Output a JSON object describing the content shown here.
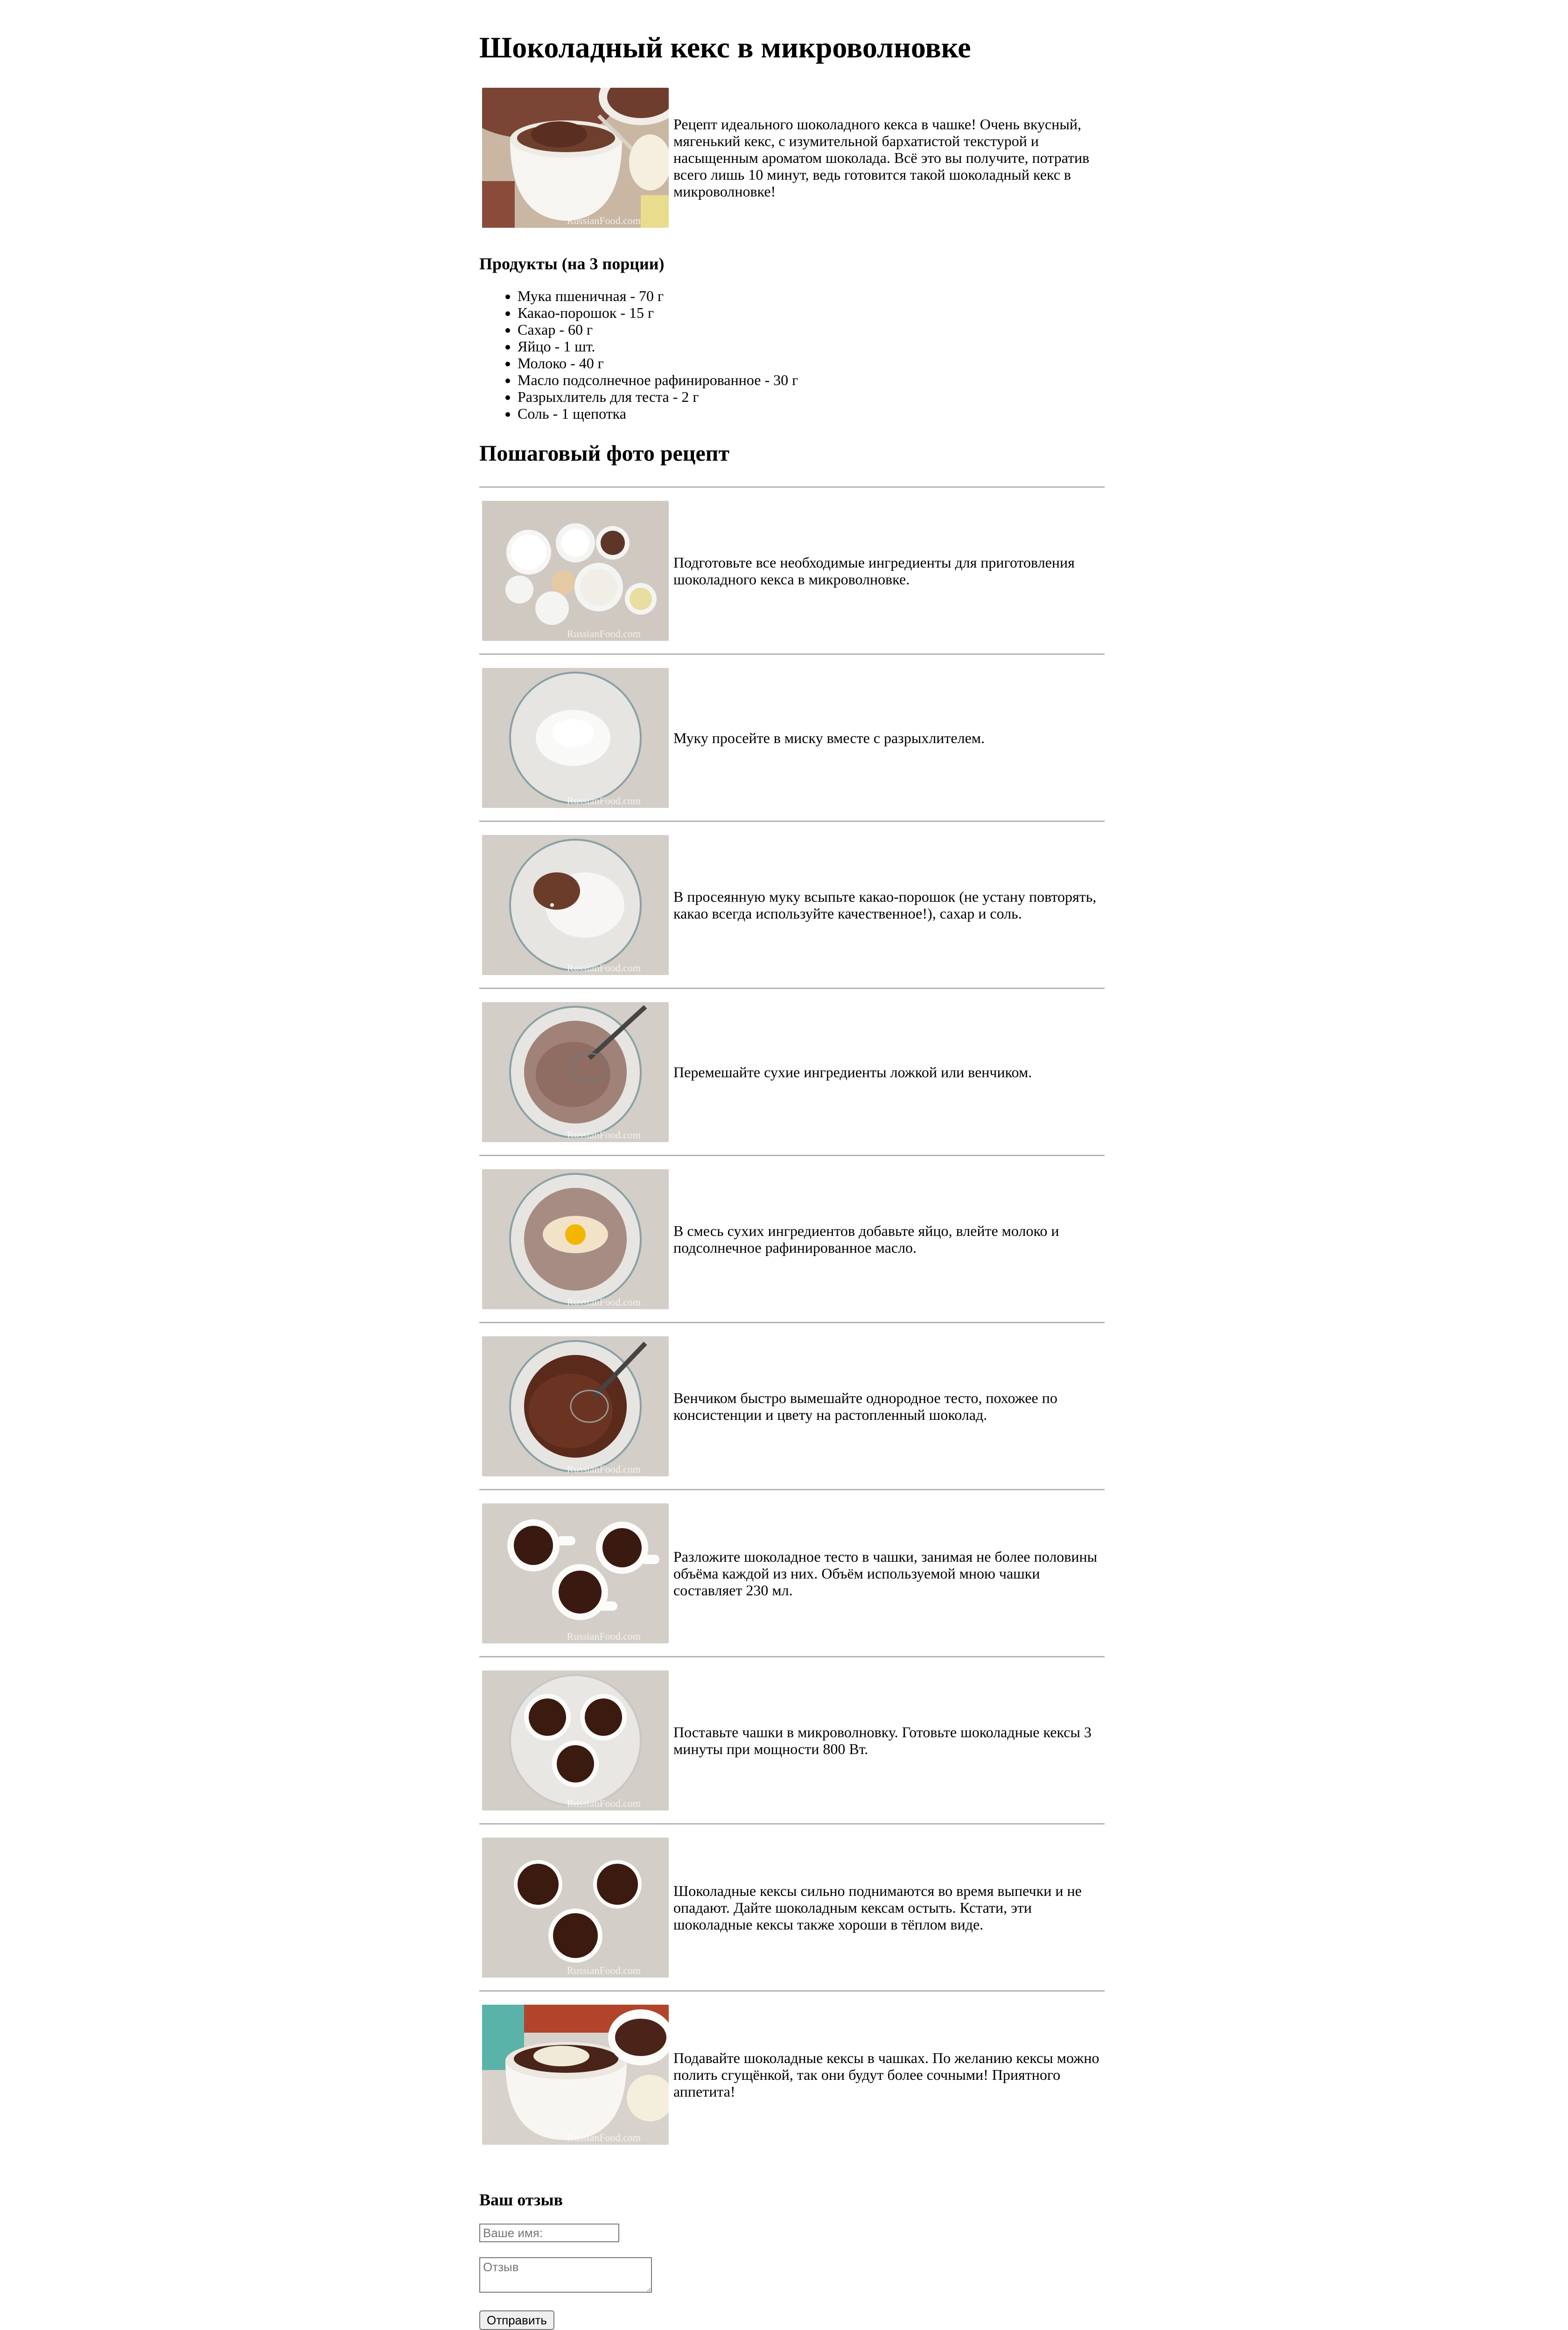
{
  "title": "Шоколадный кекс в микроволновке",
  "intro_text": "Рецепт идеального шоколадного кекса в чашке! Очень вкусный, мягенький кекс, с изумительной бархатистой текстурой и насыщенным ароматом шоколада. Всё это вы получите, потратив всего лишь 10 минут, ведь готовится такой шоколадный кекс в микроволновке!",
  "watermark": "RussianFood.com",
  "ingredients_heading": "Продукты (на 3 порции)",
  "ingredients": [
    "Мука пшеничная - 70 г",
    "Какао-порошок - 15 г",
    "Сахар - 60 г",
    "Яйцо - 1 шт.",
    "Молоко - 40 г",
    "Масло подсолнечное рафинированное - 30 г",
    "Разрыхлитель для теста - 2 г",
    "Соль - 1 щепотка"
  ],
  "steps_heading": "Пошаговый фото рецепт",
  "steps": [
    {
      "text": "Подготовьте все необходимые ингредиенты для приготовления шоколадного кекса в микроволновке."
    },
    {
      "text": "Муку просейте в миску вместе с разрыхлителем."
    },
    {
      "text": "В просеянную муку всыпьте какао-порошок (не устану повторять, какао всегда используйте качественное!), сахар и соль."
    },
    {
      "text": "Перемешайте сухие ингредиенты ложкой или венчиком."
    },
    {
      "text": "В смесь сухих ингредиентов добавьте яйцо, влейте молоко и подсолнечное рафинированное масло."
    },
    {
      "text": "Венчиком быстро вымешайте однородное тесто, похожее по консистенции и цвету на растопленный шоколад."
    },
    {
      "text": "Разложите шоколадное тесто в чашки, занимая не более половины объёма каждой из них. Объём используемой мною чашки составляет 230 мл."
    },
    {
      "text": "Поставьте чашки в микроволновку. Готовьте шоколадные кексы 3 минуты при мощности 800 Вт."
    },
    {
      "text": "Шоколадные кексы сильно поднимаются во время выпечки и не опадают. Дайте шоколадным кексам остыть. Кстати, эти шоколадные кексы также хороши в тёплом виде."
    },
    {
      "text": "Подавайте шоколадные кексы в чашках. По желанию кексы можно полить сгущёнкой, так они будут более сочными! Приятного аппетита!"
    }
  ],
  "feedback": {
    "heading": "Ваш отзыв",
    "name_placeholder": "Ваше имя:",
    "review_placeholder": "Отзыв",
    "submit_label": "Отправить"
  }
}
